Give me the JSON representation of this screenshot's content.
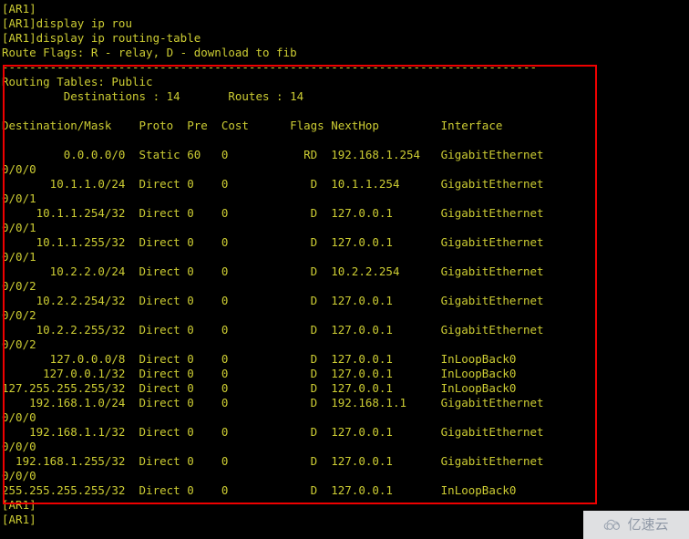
{
  "terminal": {
    "prompt_lines_top": [
      "[AR1]",
      "[AR1]display ip rou",
      "[AR1]display ip routing-table"
    ],
    "route_flags_line": "Route Flags: R - relay, D - download to fib",
    "separator_line": "------------------------------------------------------------------------------",
    "routing_table_title": "Routing Tables: Public",
    "summary_line": "         Destinations : 14       Routes : 14",
    "blank_line": "",
    "column_headers": {
      "destination_mask": "Destination/Mask",
      "proto": "Proto",
      "pre": "Pre",
      "cost": "Cost",
      "flags": "Flags",
      "nexthop": "NextHop",
      "interface": "Interface"
    },
    "header_line": "Destination/Mask    Proto   Pre  Cost      Flags NextHop         Interface",
    "routes": [
      {
        "destination_mask": "0.0.0.0/0",
        "proto": "Static",
        "pre": "60",
        "cost": "0",
        "flags": "RD",
        "nexthop": "192.168.1.254",
        "interface": "GigabitEthernet",
        "interface_wrap": "0/0/0"
      },
      {
        "destination_mask": "10.1.1.0/24",
        "proto": "Direct",
        "pre": "0",
        "cost": "0",
        "flags": "D",
        "nexthop": "10.1.1.254",
        "interface": "GigabitEthernet",
        "interface_wrap": "0/0/1"
      },
      {
        "destination_mask": "10.1.1.254/32",
        "proto": "Direct",
        "pre": "0",
        "cost": "0",
        "flags": "D",
        "nexthop": "127.0.0.1",
        "interface": "GigabitEthernet",
        "interface_wrap": "0/0/1"
      },
      {
        "destination_mask": "10.1.1.255/32",
        "proto": "Direct",
        "pre": "0",
        "cost": "0",
        "flags": "D",
        "nexthop": "127.0.0.1",
        "interface": "GigabitEthernet",
        "interface_wrap": "0/0/1"
      },
      {
        "destination_mask": "10.2.2.0/24",
        "proto": "Direct",
        "pre": "0",
        "cost": "0",
        "flags": "D",
        "nexthop": "10.2.2.254",
        "interface": "GigabitEthernet",
        "interface_wrap": "0/0/2"
      },
      {
        "destination_mask": "10.2.2.254/32",
        "proto": "Direct",
        "pre": "0",
        "cost": "0",
        "flags": "D",
        "nexthop": "127.0.0.1",
        "interface": "GigabitEthernet",
        "interface_wrap": "0/0/2"
      },
      {
        "destination_mask": "10.2.2.255/32",
        "proto": "Direct",
        "pre": "0",
        "cost": "0",
        "flags": "D",
        "nexthop": "127.0.0.1",
        "interface": "GigabitEthernet",
        "interface_wrap": "0/0/2"
      },
      {
        "destination_mask": "127.0.0.0/8",
        "proto": "Direct",
        "pre": "0",
        "cost": "0",
        "flags": "D",
        "nexthop": "127.0.0.1",
        "interface": "InLoopBack0",
        "interface_wrap": ""
      },
      {
        "destination_mask": "127.0.0.1/32",
        "proto": "Direct",
        "pre": "0",
        "cost": "0",
        "flags": "D",
        "nexthop": "127.0.0.1",
        "interface": "InLoopBack0",
        "interface_wrap": ""
      },
      {
        "destination_mask": "127.255.255.255/32",
        "proto": "Direct",
        "pre": "0",
        "cost": "0",
        "flags": "D",
        "nexthop": "127.0.0.1",
        "interface": "InLoopBack0",
        "interface_wrap": ""
      },
      {
        "destination_mask": "192.168.1.0/24",
        "proto": "Direct",
        "pre": "0",
        "cost": "0",
        "flags": "D",
        "nexthop": "192.168.1.1",
        "interface": "GigabitEthernet",
        "interface_wrap": "0/0/0"
      },
      {
        "destination_mask": "192.168.1.1/32",
        "proto": "Direct",
        "pre": "0",
        "cost": "0",
        "flags": "D",
        "nexthop": "127.0.0.1",
        "interface": "GigabitEthernet",
        "interface_wrap": "0/0/0"
      },
      {
        "destination_mask": "192.168.1.255/32",
        "proto": "Direct",
        "pre": "0",
        "cost": "0",
        "flags": "D",
        "nexthop": "127.0.0.1",
        "interface": "GigabitEthernet",
        "interface_wrap": "0/0/0"
      },
      {
        "destination_mask": "255.255.255.255/32",
        "proto": "Direct",
        "pre": "0",
        "cost": "0",
        "flags": "D",
        "nexthop": "127.0.0.1",
        "interface": "InLoopBack0",
        "interface_wrap": ""
      }
    ],
    "prompt_lines_bottom": [
      "[AR1]",
      "[AR1]"
    ]
  },
  "highlight": {
    "label": "red-annotation-box",
    "color": "#ee0000"
  },
  "watermark": {
    "text": "亿速云",
    "icon": "cloud-icon",
    "color": "#8f98a6"
  },
  "colors": {
    "background": "#000000",
    "text": "#cccc33",
    "highlight": "#ee0000"
  }
}
